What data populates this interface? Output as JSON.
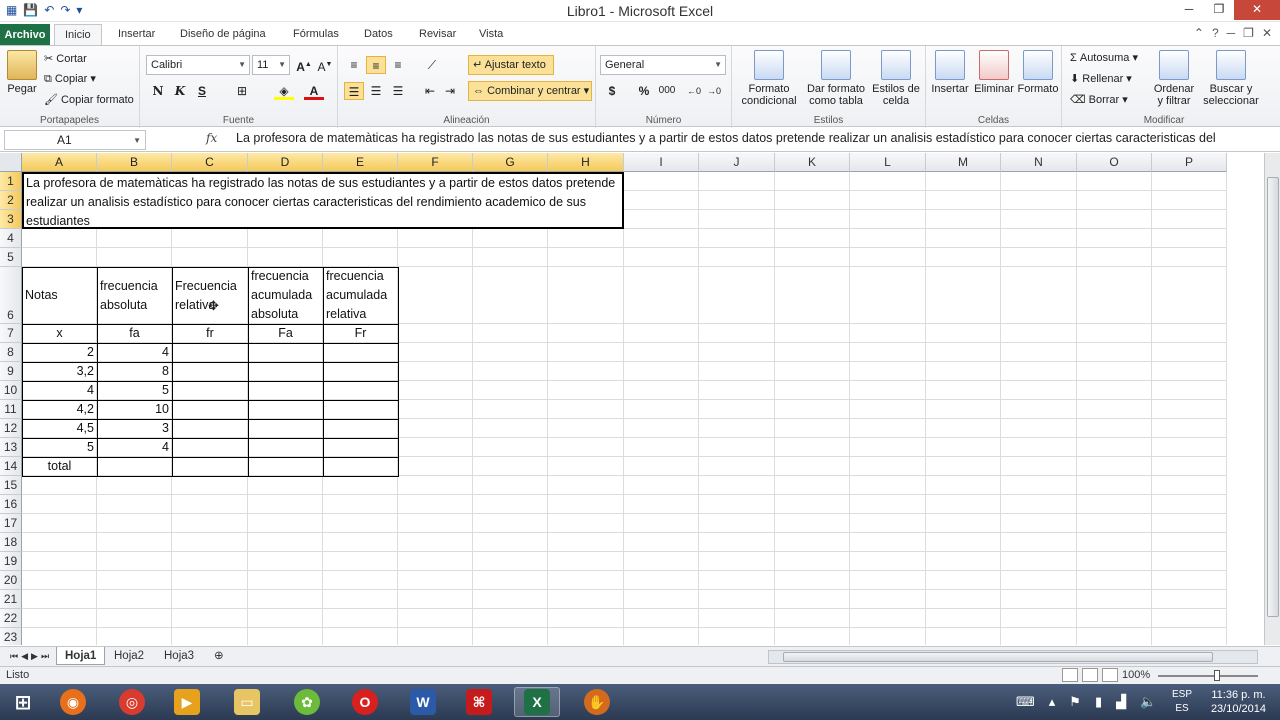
{
  "window": {
    "title": "Libro1  -  Microsoft Excel",
    "controls": [
      "─",
      "❐",
      "✕"
    ]
  },
  "tabs": {
    "file": "Archivo",
    "items": [
      "Inicio",
      "Insertar",
      "Diseño de página",
      "Fórmulas",
      "Datos",
      "Revisar",
      "Vista"
    ],
    "active": "Inicio"
  },
  "ribbon": {
    "portapapeles": {
      "label": "Portapapeles",
      "paste": "Pegar",
      "cut": "Cortar",
      "copy": "Copiar ▾",
      "format_painter": "Copiar formato"
    },
    "fuente": {
      "label": "Fuente",
      "font_name": "Calibri",
      "font_size": "11",
      "bold": "N",
      "italic": "K",
      "underline": "S"
    },
    "alineacion": {
      "label": "Alineación",
      "wrap_text": "Ajustar texto",
      "merge_center": "Combinar y centrar"
    },
    "numero": {
      "label": "Número",
      "format": "General",
      "currency": "$",
      "percent": "%",
      "thousands": "000"
    },
    "estilos": {
      "label": "Estilos",
      "conditional": "Formato\ncondicional",
      "as_table": "Dar formato\ncomo tabla",
      "cell_styles": "Estilos de\ncelda"
    },
    "celdas": {
      "label": "Celdas",
      "insert": "Insertar",
      "delete": "Eliminar",
      "format": "Formato"
    },
    "modificar": {
      "label": "Modificar",
      "autosum": "Σ  Autosuma ▾",
      "fill": "Rellenar ▾",
      "clear": "Borrar ▾",
      "sort": "Ordenar\ny filtrar",
      "find": "Buscar y\nseleccionar"
    }
  },
  "formula_bar": {
    "name_box": "A1",
    "fx": "fx",
    "content": "La profesora de matemàticas ha registrado las notas de sus estudiantes y a partir de estos datos pretende realizar un analisis estadístico para conocer ciertas caracteristicas del"
  },
  "columns": [
    "A",
    "B",
    "C",
    "D",
    "E",
    "F",
    "G",
    "H",
    "I",
    "J",
    "K",
    "L",
    "M",
    "N",
    "O",
    "P"
  ],
  "rows": [
    "1",
    "2",
    "3",
    "4",
    "5",
    "6",
    "7",
    "8",
    "9",
    "10",
    "11",
    "12",
    "13",
    "14",
    "15",
    "16",
    "17",
    "18",
    "19",
    "20",
    "21",
    "22",
    "23"
  ],
  "sheet": {
    "merged_text": "La profesora de matemàticas ha registrado las notas de sus estudiantes y a partir de estos datos pretende realizar un analisis estadístico para conocer ciertas caracteristicas del rendimiento academico de sus estudiantes",
    "headers": [
      "Notas",
      "frecuencia absoluta",
      "Frecuencia relativa",
      "frecuencia acumulada absoluta",
      "frecuencia acumulada relativa"
    ],
    "symbols": [
      "x",
      "fa",
      "fr",
      "Fa",
      "Fr"
    ],
    "x_values": [
      "2",
      "3,2",
      "4",
      "4,2",
      "4,5",
      "5"
    ],
    "fa_values": [
      "4",
      "8",
      "5",
      "10",
      "3",
      "4"
    ],
    "total_label": "total"
  },
  "sheet_tabs": [
    "Hoja1",
    "Hoja2",
    "Hoja3"
  ],
  "status": {
    "ready": "Listo",
    "zoom": "100%"
  },
  "taskbar": {
    "lang_top": "ESP",
    "lang_bottom": "ES",
    "time": "11:36 p. m.",
    "date": "23/10/2014"
  }
}
